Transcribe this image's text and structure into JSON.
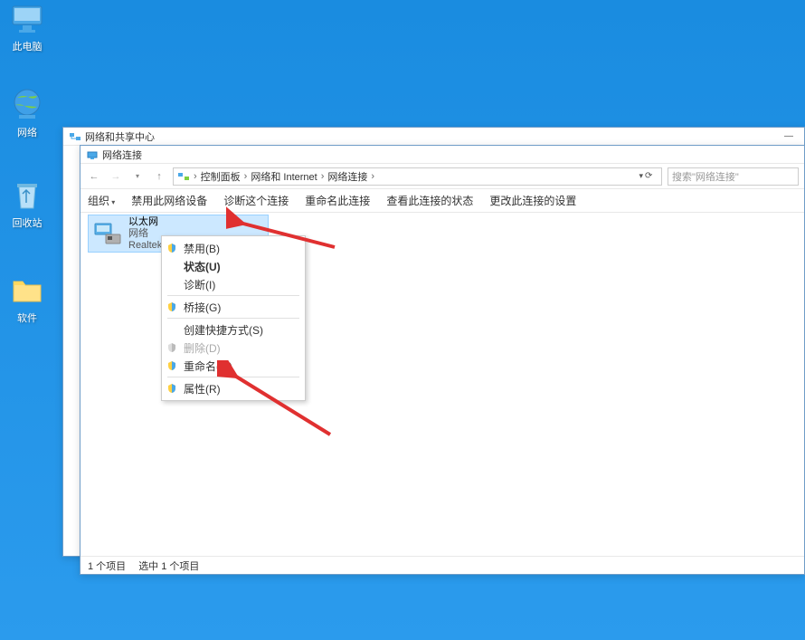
{
  "desktop": {
    "icons": [
      {
        "label": "此电脑"
      },
      {
        "label": "网络"
      },
      {
        "label": "回收站"
      },
      {
        "label": "软件"
      }
    ]
  },
  "parent_window": {
    "title": "网络和共享中心"
  },
  "child_window": {
    "title": "网络连接",
    "breadcrumb": {
      "items": [
        "控制面板",
        "网络和 Internet",
        "网络连接"
      ]
    },
    "search_placeholder": "搜索\"网络连接\"",
    "commands": {
      "organize": "组织",
      "disable": "禁用此网络设备",
      "diagnose": "诊断这个连接",
      "rename": "重命名此连接",
      "status": "查看此连接的状态",
      "settings": "更改此连接的设置"
    },
    "connection": {
      "name": "以太网",
      "line2": "网络",
      "line3": "Realtek"
    },
    "statusbar": {
      "items": "1 个项目",
      "selected": "选中 1 个项目"
    }
  },
  "context_menu": {
    "disable": "禁用(B)",
    "status": "状态(U)",
    "diagnose": "诊断(I)",
    "bridge": "桥接(G)",
    "shortcut": "创建快捷方式(S)",
    "delete": "删除(D)",
    "rename": "重命名(M)",
    "properties": "属性(R)"
  }
}
